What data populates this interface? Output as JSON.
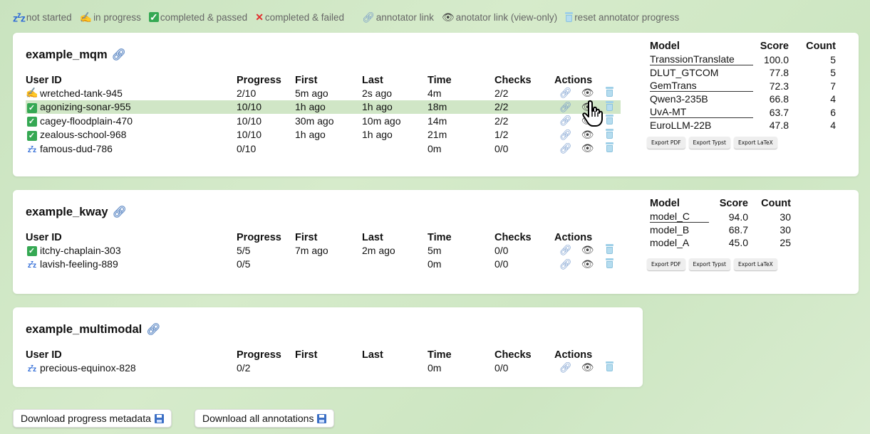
{
  "legend": [
    {
      "icon": "zzz",
      "label": "not started"
    },
    {
      "icon": "pen",
      "label": "in progress"
    },
    {
      "icon": "check",
      "label": "completed & passed"
    },
    {
      "icon": "cross",
      "label": "completed & failed"
    },
    {
      "icon": "link",
      "label": "annotator link"
    },
    {
      "icon": "eye",
      "label": "anotator link (view-only)"
    },
    {
      "icon": "bin",
      "label": "reset annotator progress"
    }
  ],
  "headers": {
    "user": "User ID",
    "progress": "Progress",
    "first": "First",
    "last": "Last",
    "time": "Time",
    "checks": "Checks",
    "actions": "Actions"
  },
  "campaigns": [
    {
      "name": "example_mqm",
      "users": [
        {
          "status": "pen",
          "id": "wretched-tank-945",
          "progress": "2/10",
          "first": "5m ago",
          "last": "2s ago",
          "time": "4m",
          "checks": "2/2"
        },
        {
          "status": "check",
          "id": "agonizing-sonar-955",
          "progress": "10/10",
          "first": "1h ago",
          "last": "1h ago",
          "time": "18m",
          "checks": "2/2",
          "highlight": true
        },
        {
          "status": "check",
          "id": "cagey-floodplain-470",
          "progress": "10/10",
          "first": "30m ago",
          "last": "10m ago",
          "time": "14m",
          "checks": "2/2"
        },
        {
          "status": "check",
          "id": "zealous-school-968",
          "progress": "10/10",
          "first": "1h ago",
          "last": "1h ago",
          "time": "21m",
          "checks": "1/2"
        },
        {
          "status": "zzz",
          "id": "famous-dud-786",
          "progress": "0/10",
          "first": "",
          "last": "",
          "time": "0m",
          "checks": "0/0"
        }
      ],
      "scores": {
        "headers": {
          "model": "Model",
          "score": "Score",
          "count": "Count"
        },
        "rows": [
          {
            "model": "TranssionTranslate",
            "score": "100.0",
            "count": "5",
            "underline": true
          },
          {
            "model": "DLUT_GTCOM",
            "score": "77.8",
            "count": "5"
          },
          {
            "model": "GemTrans",
            "score": "72.3",
            "count": "7",
            "underline": true
          },
          {
            "model": "Qwen3-235B",
            "score": "66.8",
            "count": "4"
          },
          {
            "model": "UvA-MT",
            "score": "63.7",
            "count": "6",
            "underline": true
          },
          {
            "model": "EuroLLM-22B",
            "score": "47.8",
            "count": "4"
          }
        ],
        "exports": [
          "Export PDF",
          "Export Typst",
          "Export LaTeX"
        ]
      }
    },
    {
      "name": "example_kway",
      "users": [
        {
          "status": "check",
          "id": "itchy-chaplain-303",
          "progress": "5/5",
          "first": "7m ago",
          "last": "2m ago",
          "time": "5m",
          "checks": "0/0"
        },
        {
          "status": "zzz",
          "id": "lavish-feeling-889",
          "progress": "0/5",
          "first": "",
          "last": "",
          "time": "0m",
          "checks": "0/0"
        }
      ],
      "scores": {
        "headers": {
          "model": "Model",
          "score": "Score",
          "count": "Count"
        },
        "rows": [
          {
            "model": "model_C",
            "score": "94.0",
            "count": "30",
            "underline": true
          },
          {
            "model": "model_B",
            "score": "68.7",
            "count": "30"
          },
          {
            "model": "model_A",
            "score": "45.0",
            "count": "25"
          }
        ],
        "exports": [
          "Export PDF",
          "Export Typst",
          "Export LaTeX"
        ]
      }
    },
    {
      "name": "example_multimodal",
      "users": [
        {
          "status": "zzz",
          "id": "precious-equinox-828",
          "progress": "0/2",
          "first": "",
          "last": "",
          "time": "0m",
          "checks": "0/0"
        }
      ]
    }
  ],
  "buttons": {
    "download_metadata": "Download progress metadata",
    "download_annotations": "Download all annotations"
  }
}
